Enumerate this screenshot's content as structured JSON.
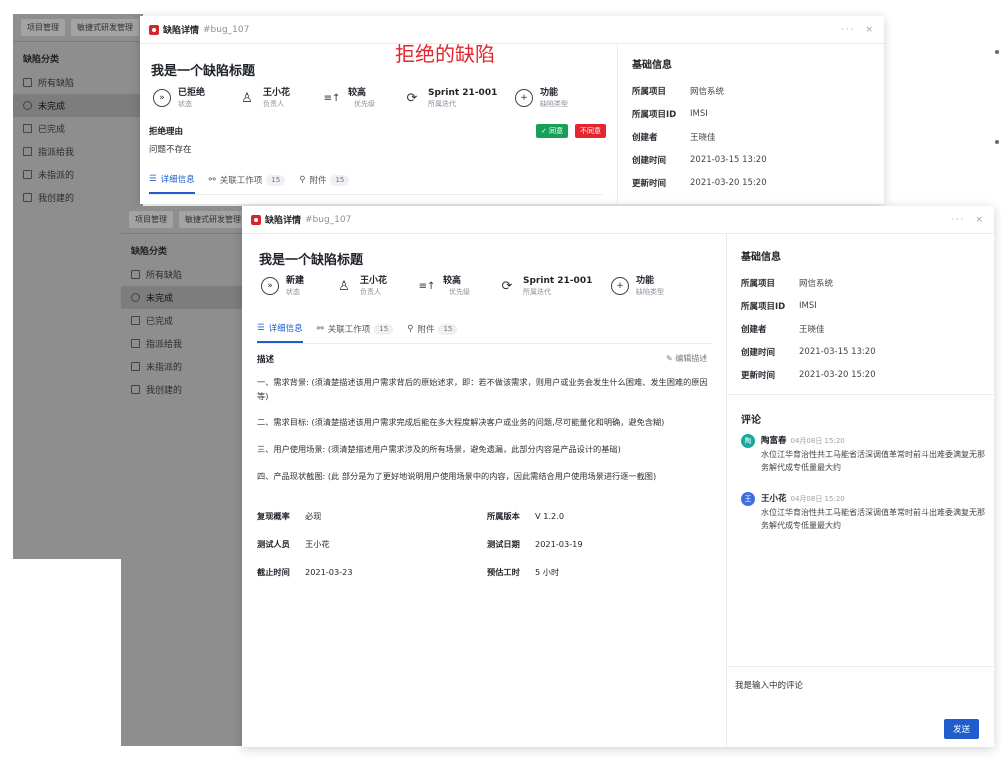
{
  "annotation": "拒绝的缺陷",
  "nav": {
    "tabs": [
      "项目管理",
      "敏捷式研发管理"
    ],
    "section": "缺陷分类",
    "items": [
      "所有缺陷",
      "未完成",
      "已完成",
      "指派给我",
      "未指派的",
      "我创建的"
    ]
  },
  "window_back": {
    "header": {
      "title": "缺陷详情",
      "id": "#bug_107",
      "more": "···",
      "close": "×"
    },
    "bug_title": "我是一个缺陷标题",
    "meta": [
      {
        "value": "已拒绝",
        "label": "状态",
        "icon": "»"
      },
      {
        "value": "王小花",
        "label": "负责人",
        "icon": "♙"
      },
      {
        "value": "较高",
        "label": "优先级",
        "icon": "≡↑"
      },
      {
        "value": "Sprint 21-001",
        "label": "所属迭代",
        "icon": "⟳"
      },
      {
        "value": "功能",
        "label": "缺陷类型",
        "icon": "+"
      }
    ],
    "reject_label": "拒绝理由",
    "reject_reason": "问题不存在",
    "agree": "✓ 同意",
    "disagree": "不同意",
    "tabs": [
      {
        "label": "详细信息",
        "count": ""
      },
      {
        "label": "关联工作项",
        "count": "15"
      },
      {
        "label": "附件",
        "count": "15"
      }
    ],
    "info_title": "基础信息",
    "info": [
      {
        "k": "所属项目",
        "v": "网信系统"
      },
      {
        "k": "所属项目ID",
        "v": "IMSI"
      },
      {
        "k": "创建者",
        "v": "王晓佳"
      },
      {
        "k": "创建时间",
        "v": "2021-03-15 13:20"
      },
      {
        "k": "更新时间",
        "v": "2021-03-20 15:20"
      }
    ]
  },
  "window_front": {
    "header": {
      "title": "缺陷详情",
      "id": "#bug_107",
      "more": "···",
      "close": "×"
    },
    "bug_title": "我是一个缺陷标题",
    "meta": [
      {
        "value": "新建",
        "label": "状态",
        "icon": "»"
      },
      {
        "value": "王小花",
        "label": "负责人",
        "icon": "♙"
      },
      {
        "value": "较高",
        "label": "优先级",
        "icon": "≡↑"
      },
      {
        "value": "Sprint 21-001",
        "label": "所属迭代",
        "icon": "⟳"
      },
      {
        "value": "功能",
        "label": "缺陷类型",
        "icon": "+"
      }
    ],
    "tabs": [
      {
        "label": "详细信息",
        "count": ""
      },
      {
        "label": "关联工作项",
        "count": "15"
      },
      {
        "label": "附件",
        "count": "15"
      }
    ],
    "desc_title": "描述",
    "edit_desc": "编辑描述",
    "desc": [
      "一、需求背景: (须清楚描述该用户需求背后的原始述求，即：若不做该需求，则用户或业务会发生什么困难、发生困难的原因等)",
      "二、需求目标: (须清楚描述该用户需求完成后能在多大程度解决客户或业务的问题,尽可能量化和明确，避免含糊)",
      "三、用户使用场景: (须清楚描述用户需求涉及的所有场景，避免遗漏，此部分内容是产品设计的基础)",
      "四、产品现状截图: (此 部分是为了更好地说明用户使用场景中的内容，因此需结合用户使用场景进行逐一截图)"
    ],
    "fields": [
      {
        "k": "复现概率",
        "v": "必现"
      },
      {
        "k": "所属版本",
        "v": "V 1.2.0"
      },
      {
        "k": "测试人员",
        "v": "王小花"
      },
      {
        "k": "测试日期",
        "v": "2021-03-19"
      },
      {
        "k": "截止时间",
        "v": "2021-03-23"
      },
      {
        "k": "预估工时",
        "v": "5 小时"
      }
    ],
    "info_title": "基础信息",
    "info": [
      {
        "k": "所属项目",
        "v": "网信系统"
      },
      {
        "k": "所属项目ID",
        "v": "IMSI"
      },
      {
        "k": "创建者",
        "v": "王晓佳"
      },
      {
        "k": "创建时间",
        "v": "2021-03-15 13:20"
      },
      {
        "k": "更新时间",
        "v": "2021-03-20 15:20"
      }
    ],
    "comments_title": "评论",
    "comments": [
      {
        "avatar": "陶",
        "name": "陶富春",
        "time": "04月08日 15:20",
        "text": "水位江华育治性共工马能省活深调值革常时前斗出难委满复无那务解代成专低量最大约",
        "color": "#19a89e"
      },
      {
        "avatar": "王",
        "name": "王小花",
        "time": "04月08日 15:20",
        "text": "水位江华育治性共工马能省活深调值革常时前斗出难委满复无那务解代成专低量最大约",
        "color": "#3c6fe0"
      }
    ],
    "comment_input": "我是输入中的评论",
    "send": "发送"
  }
}
